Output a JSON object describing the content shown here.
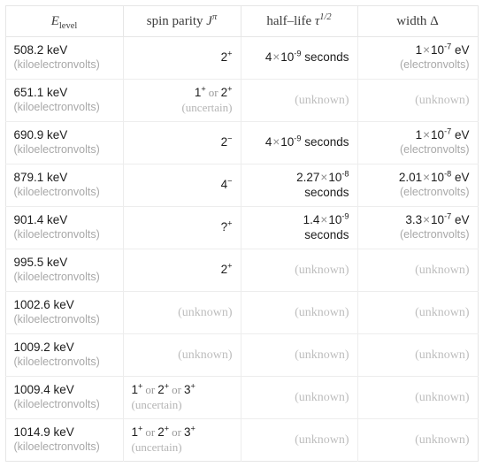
{
  "table": {
    "headers": [
      {
        "id": "energy",
        "text": "E_level",
        "base": "E",
        "sub": "level"
      },
      {
        "id": "spin",
        "text": "spin parity Jπ",
        "base": "spin parity",
        "sym": "J",
        "sup": "π"
      },
      {
        "id": "half",
        "text": "half–life τ_1/2",
        "base": "half–life",
        "sym": "τ",
        "sub": "1/2"
      },
      {
        "id": "width",
        "text": "width Δ",
        "base": "width",
        "sym": "Δ"
      }
    ],
    "unit_notes": {
      "energy": "(kiloelectronvolts)",
      "width": "(electronvolts)",
      "unknown": "(unknown)",
      "uncertain": "(uncertain)"
    },
    "labels": {
      "kev": "keV",
      "ev": "eV",
      "seconds": "seconds",
      "or": "or",
      "times": "×"
    },
    "rows": [
      {
        "energy_value": "508.2 keV",
        "energy_note": "(kiloelectronvolts)",
        "spin": {
          "type": "single",
          "value": "2",
          "parity": "+"
        },
        "half": {
          "type": "value",
          "mantissa": "4",
          "exp": "-9",
          "unit": "seconds",
          "wrap": false
        },
        "width": {
          "type": "value",
          "mantissa": "1",
          "exp": "-7",
          "unit": "eV",
          "note": "(electronvolts)"
        }
      },
      {
        "energy_value": "651.1 keV",
        "energy_note": "(kiloelectronvolts)",
        "spin": {
          "type": "multi",
          "options": [
            {
              "value": "1",
              "parity": "+"
            },
            {
              "value": "2",
              "parity": "+"
            }
          ],
          "note": "(uncertain)"
        },
        "half": {
          "type": "unknown",
          "text": "(unknown)"
        },
        "width": {
          "type": "unknown",
          "text": "(unknown)"
        }
      },
      {
        "energy_value": "690.9 keV",
        "energy_note": "(kiloelectronvolts)",
        "spin": {
          "type": "single",
          "value": "2",
          "parity": "−"
        },
        "half": {
          "type": "value",
          "mantissa": "4",
          "exp": "-9",
          "unit": "seconds",
          "wrap": false
        },
        "width": {
          "type": "value",
          "mantissa": "1",
          "exp": "-7",
          "unit": "eV",
          "note": "(electronvolts)"
        }
      },
      {
        "energy_value": "879.1 keV",
        "energy_note": "(kiloelectronvolts)",
        "spin": {
          "type": "single",
          "value": "4",
          "parity": "−"
        },
        "half": {
          "type": "value",
          "mantissa": "2.27",
          "exp": "-8",
          "unit": "seconds",
          "wrap": true
        },
        "width": {
          "type": "value",
          "mantissa": "2.01",
          "exp": "-8",
          "unit": "eV",
          "note": "(electronvolts)"
        }
      },
      {
        "energy_value": "901.4 keV",
        "energy_note": "(kiloelectronvolts)",
        "spin": {
          "type": "single",
          "value": "?",
          "parity": "+"
        },
        "half": {
          "type": "value",
          "mantissa": "1.4",
          "exp": "-9",
          "unit": "seconds",
          "wrap": true
        },
        "width": {
          "type": "value",
          "mantissa": "3.3",
          "exp": "-7",
          "unit": "eV",
          "note": "(electronvolts)"
        }
      },
      {
        "energy_value": "995.5 keV",
        "energy_note": "(kiloelectronvolts)",
        "spin": {
          "type": "single",
          "value": "2",
          "parity": "+"
        },
        "half": {
          "type": "unknown",
          "text": "(unknown)"
        },
        "width": {
          "type": "unknown",
          "text": "(unknown)"
        }
      },
      {
        "energy_value": "1002.6 keV",
        "energy_note": "(kiloelectronvolts)",
        "spin": {
          "type": "unknown",
          "text": "(unknown)"
        },
        "half": {
          "type": "unknown",
          "text": "(unknown)"
        },
        "width": {
          "type": "unknown",
          "text": "(unknown)"
        }
      },
      {
        "energy_value": "1009.2 keV",
        "energy_note": "(kiloelectronvolts)",
        "spin": {
          "type": "unknown",
          "text": "(unknown)"
        },
        "half": {
          "type": "unknown",
          "text": "(unknown)"
        },
        "width": {
          "type": "unknown",
          "text": "(unknown)"
        }
      },
      {
        "energy_value": "1009.4 keV",
        "energy_note": "(kiloelectronvolts)",
        "spin": {
          "type": "multi",
          "options": [
            {
              "value": "1",
              "parity": "+"
            },
            {
              "value": "2",
              "parity": "+"
            },
            {
              "value": "3",
              "parity": "+"
            }
          ],
          "note": "(uncertain)",
          "fill": true
        },
        "half": {
          "type": "unknown",
          "text": "(unknown)"
        },
        "width": {
          "type": "unknown",
          "text": "(unknown)"
        }
      },
      {
        "energy_value": "1014.9 keV",
        "energy_note": "(kiloelectronvolts)",
        "spin": {
          "type": "multi",
          "options": [
            {
              "value": "1",
              "parity": "+"
            },
            {
              "value": "2",
              "parity": "+"
            },
            {
              "value": "3",
              "parity": "+"
            }
          ],
          "note": "(uncertain)",
          "fill": true
        },
        "half": {
          "type": "unknown",
          "text": "(unknown)"
        },
        "width": {
          "type": "unknown",
          "text": "(unknown)"
        }
      }
    ]
  },
  "colors": {
    "border": "#e6e6e6",
    "row_border": "#ededed",
    "text": "#1c1c1c",
    "muted": "#a8a8a8",
    "unknown": "#bdbdbd",
    "header": "#3c3c3c",
    "background": "#ffffff"
  }
}
